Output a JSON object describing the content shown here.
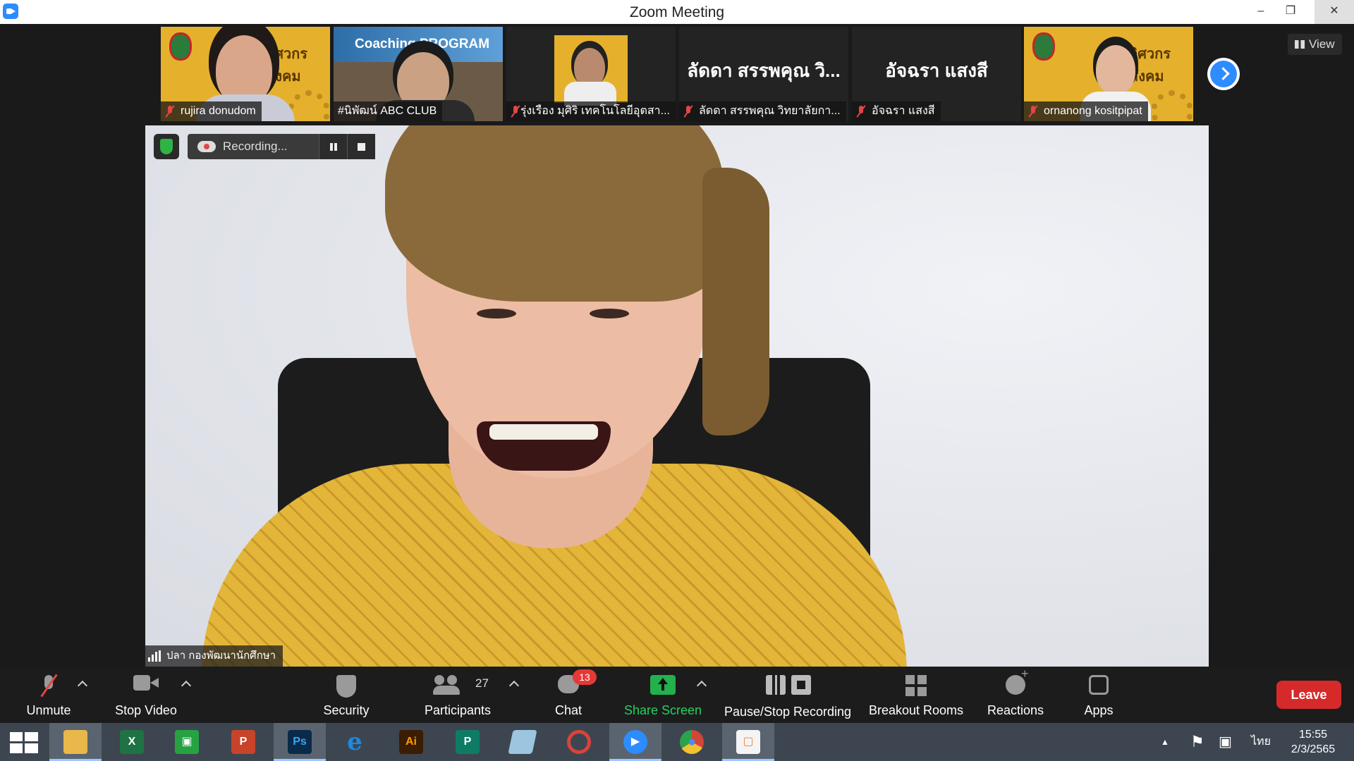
{
  "window": {
    "title": "Zoom Meeting",
    "min_glyph": "–",
    "max_glyph": "❐",
    "close_glyph": "✕"
  },
  "strip": {
    "view_label": "View",
    "participants": [
      {
        "name": "rujira donudom",
        "muted": true
      },
      {
        "name": "#นิพัฒน์ ABC CLUB",
        "muted": false,
        "banner": "Coaching PROGRAM"
      },
      {
        "name": "รุ่งเรือง มุศิริ เทคโนโลยีอุตสา...",
        "muted": true
      },
      {
        "name": "ลัดดา สรรพคุณ วิทยาลัยกา...",
        "muted": true,
        "display_name": "ลัดดา สรรพคุณ วิ..."
      },
      {
        "name": "อัจฉรา แสงสี",
        "muted": true,
        "display_name": "อัจฉรา แสงสี"
      },
      {
        "name": "ornanong kositpipat",
        "muted": true
      }
    ],
    "thumb_logo_text": "วิศวกรสังคม"
  },
  "main_video": {
    "recording_label": "Recording...",
    "speaker_name": "ปลา กองพัฒนานักศึกษา"
  },
  "toolbar": {
    "unmute_label": "Unmute",
    "stop_video_label": "Stop Video",
    "security_label": "Security",
    "participants_label": "Participants",
    "participants_count": "27",
    "chat_label": "Chat",
    "chat_badge": "13",
    "share_label": "Share Screen",
    "pause_stop_label": "Pause/Stop Recording",
    "breakout_label": "Breakout Rooms",
    "reactions_label": "Reactions",
    "apps_label": "Apps",
    "leave_label": "Leave"
  },
  "taskbar": {
    "apps": [
      {
        "id": "file-explorer",
        "glyph": "",
        "color": "#e8b84a"
      },
      {
        "id": "excel",
        "glyph": "X",
        "color": "#1f7244"
      },
      {
        "id": "store",
        "glyph": "▣",
        "color": "#27a243"
      },
      {
        "id": "powerpoint",
        "glyph": "P",
        "color": "#c9432b"
      },
      {
        "id": "photoshop",
        "glyph": "Ps",
        "color": "#0b2a4a"
      },
      {
        "id": "internet-explorer",
        "glyph": "e",
        "color": "#1b8adf"
      },
      {
        "id": "illustrator",
        "glyph": "Ai",
        "color": "#3a1d03"
      },
      {
        "id": "publisher",
        "glyph": "P",
        "color": "#0e7c65"
      },
      {
        "id": "notes",
        "glyph": "",
        "color": "#9cc6e0"
      },
      {
        "id": "photoscape",
        "glyph": "",
        "color": "#8a8a8a"
      },
      {
        "id": "zoom",
        "glyph": "▶",
        "color": "#2d8cff"
      },
      {
        "id": "chrome",
        "glyph": "●",
        "color": "#d4453a"
      },
      {
        "id": "photo-viewer",
        "glyph": "▢",
        "color": "#f07d3a"
      }
    ],
    "language": "ไทย",
    "time": "15:55",
    "date": "2/3/2565"
  },
  "colors": {
    "zoom_blue": "#2d8cff",
    "leave_red": "#d62a2a",
    "share_green": "#23b14d",
    "muted_red": "#e54545"
  }
}
